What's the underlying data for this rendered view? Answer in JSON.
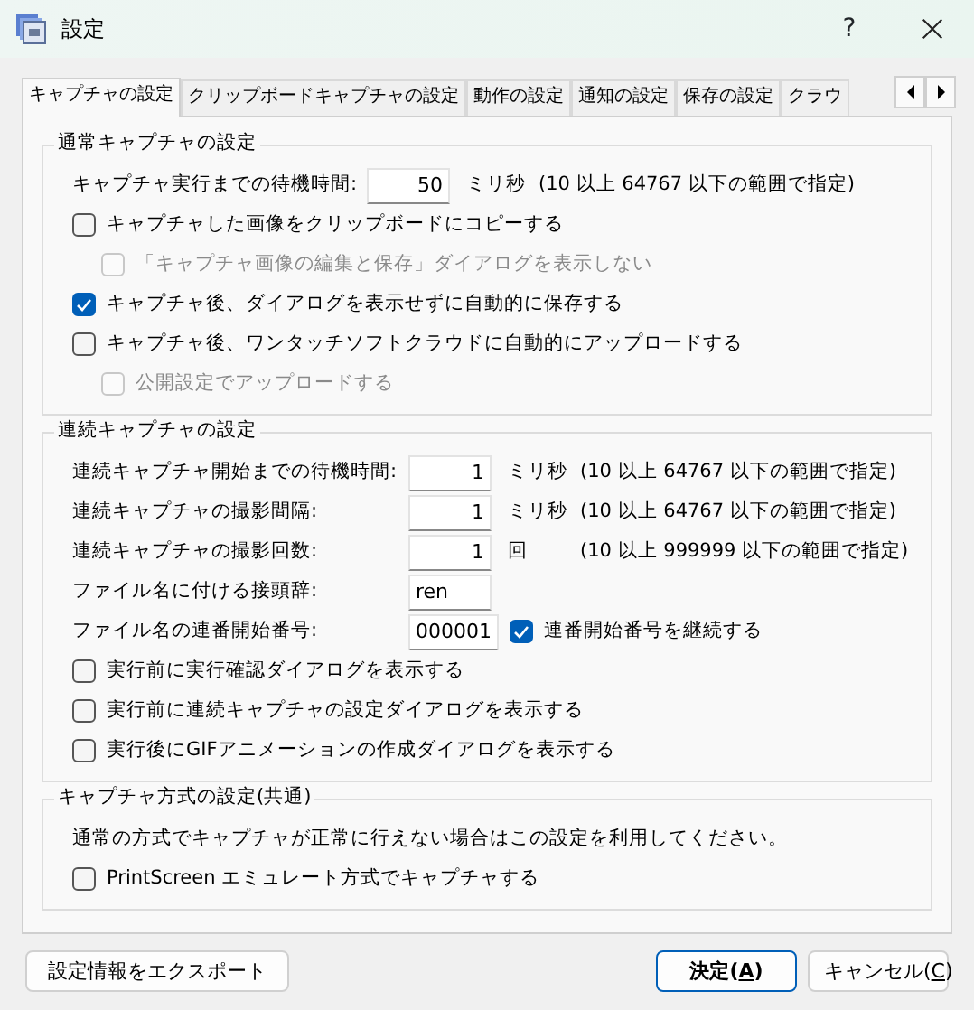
{
  "window": {
    "title": "設定",
    "help": "?"
  },
  "tabs": [
    {
      "label": "キャプチャの設定",
      "selected": true
    },
    {
      "label": "クリップボードキャプチャの設定",
      "selected": false
    },
    {
      "label": "動作の設定",
      "selected": false
    },
    {
      "label": "通知の設定",
      "selected": false
    },
    {
      "label": "保存の設定",
      "selected": false
    },
    {
      "label": "クラウ",
      "selected": false
    }
  ],
  "groups": [
    {
      "title": "通常キャプチャの設定",
      "rows": [
        {
          "kind": "number",
          "label": "キャプチャ実行までの待機時間:",
          "value": "50",
          "unit": "ミリ秒",
          "range": "(10 以上 64767 以下の範囲で指定)"
        },
        {
          "kind": "checkbox",
          "label": "キャプチャした画像をクリップボードにコピーする",
          "checked": false,
          "disabled": false,
          "children": [
            {
              "kind": "checkbox",
              "label": "「キャプチャ画像の編集と保存」ダイアログを表示しない",
              "checked": false,
              "disabled": true
            }
          ]
        },
        {
          "kind": "checkbox",
          "label": "キャプチャ後、ダイアログを表示せずに自動的に保存する",
          "checked": true,
          "disabled": false
        },
        {
          "kind": "checkbox",
          "label": "キャプチャ後、ワンタッチソフトクラウドに自動的にアップロードする",
          "checked": false,
          "disabled": false,
          "children": [
            {
              "kind": "checkbox",
              "label": "公開設定でアップロードする",
              "checked": false,
              "disabled": true
            }
          ]
        }
      ]
    },
    {
      "title": "連続キャプチャの設定",
      "rows": [
        {
          "kind": "number",
          "label": "連続キャプチャ開始までの待機時間:",
          "value": "1",
          "unit": "ミリ秒",
          "range": "(10 以上 64767 以下の範囲で指定)"
        },
        {
          "kind": "number",
          "label": "連続キャプチャの撮影間隔:",
          "value": "1",
          "unit": "ミリ秒",
          "range": "(10 以上 64767 以下の範囲で指定)"
        },
        {
          "kind": "number",
          "label": "連続キャプチャの撮影回数:",
          "value": "1",
          "unit": "回",
          "range": "(10 以上 999999 以下の範囲で指定)"
        },
        {
          "kind": "text",
          "label": "ファイル名に付ける接頭辞:",
          "value": "ren"
        },
        {
          "kind": "number_check",
          "label": "ファイル名の連番開始番号:",
          "value": "000001",
          "check_label": "連番開始番号を継続する",
          "checked": true
        },
        {
          "kind": "checkbox",
          "label": "実行前に実行確認ダイアログを表示する",
          "checked": false,
          "disabled": false
        },
        {
          "kind": "checkbox",
          "label": "実行前に連続キャプチャの設定ダイアログを表示する",
          "checked": false,
          "disabled": false
        },
        {
          "kind": "checkbox",
          "label": "実行後にGIFアニメーションの作成ダイアログを表示する",
          "checked": false,
          "disabled": false
        }
      ]
    },
    {
      "title": "キャプチャ方式の設定(共通)",
      "rows": [
        {
          "kind": "note",
          "label": "通常の方式でキャプチャが正常に行えない場合はこの設定を利用してください。"
        },
        {
          "kind": "checkbox",
          "label": "PrintScreen エミュレート方式でキャプチャする",
          "checked": false,
          "disabled": false
        }
      ]
    }
  ],
  "buttons": [
    {
      "label_parts": [
        "設定情報をエクスポート"
      ],
      "kind": "export"
    },
    {
      "label_parts": [
        "決定(",
        "A",
        ")"
      ],
      "kind": "default"
    },
    {
      "label_parts": [
        "キャンセル(",
        "C",
        ")"
      ],
      "kind": "cancel"
    }
  ]
}
